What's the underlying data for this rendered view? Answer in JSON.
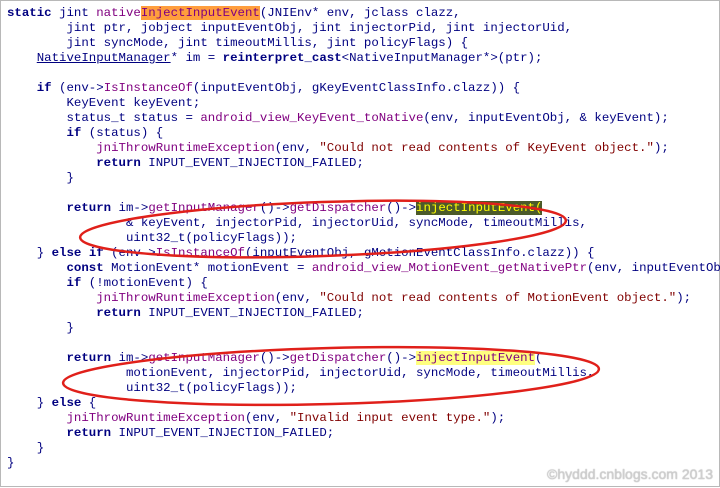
{
  "code_lines": [
    [
      {
        "t": "static",
        "c": "kw"
      },
      {
        "t": " "
      },
      {
        "t": "jint",
        "c": "ty"
      },
      {
        "t": " "
      },
      {
        "t": "native",
        "c": "fn"
      },
      {
        "t": "InjectInputEvent",
        "c": "hl1"
      },
      {
        "t": "(JNIEnv* env, jclass clazz,",
        "c": "var"
      }
    ],
    [
      {
        "t": "        jint ptr, jobject inputEventObj, jint injectorPid, jint injectorUid,",
        "c": "var"
      }
    ],
    [
      {
        "t": "        jint syncMode, jint timeoutMillis, jint policyFlags) {",
        "c": "var"
      }
    ],
    [
      {
        "t": "    "
      },
      {
        "t": "NativeInputManager",
        "c": "tu"
      },
      {
        "t": "* im = ",
        "c": "var"
      },
      {
        "t": "reinterpret_cast",
        "c": "kw"
      },
      {
        "t": "<NativeInputManager*>(ptr);",
        "c": "var"
      }
    ],
    [
      {
        "t": ""
      }
    ],
    [
      {
        "t": "    "
      },
      {
        "t": "if",
        "c": "kw"
      },
      {
        "t": " (env->",
        "c": "var"
      },
      {
        "t": "IsInstanceOf",
        "c": "fn"
      },
      {
        "t": "(inputEventObj, gKeyEventClassInfo.clazz)) {",
        "c": "var"
      }
    ],
    [
      {
        "t": "        KeyEvent keyEvent;",
        "c": "var"
      }
    ],
    [
      {
        "t": "        status_t status = ",
        "c": "var"
      },
      {
        "t": "android_view_KeyEvent_toNative",
        "c": "fn"
      },
      {
        "t": "(env, inputEventObj, & keyEvent);",
        "c": "var"
      }
    ],
    [
      {
        "t": "        "
      },
      {
        "t": "if",
        "c": "kw"
      },
      {
        "t": " (status) {",
        "c": "var"
      }
    ],
    [
      {
        "t": "            "
      },
      {
        "t": "jniThrowRuntimeException",
        "c": "fn"
      },
      {
        "t": "(env, ",
        "c": "var"
      },
      {
        "t": "\"Could not read contents of KeyEvent object.\"",
        "c": "str"
      },
      {
        "t": ");",
        "c": "var"
      }
    ],
    [
      {
        "t": "            "
      },
      {
        "t": "return",
        "c": "kw"
      },
      {
        "t": " INPUT_EVENT_INJECTION_FAILED;",
        "c": "var"
      }
    ],
    [
      {
        "t": "        }",
        "c": "var"
      }
    ],
    [
      {
        "t": ""
      }
    ],
    [
      {
        "t": "        "
      },
      {
        "t": "return",
        "c": "kw"
      },
      {
        "t": " im->",
        "c": "var"
      },
      {
        "t": "getInputManager",
        "c": "fn"
      },
      {
        "t": "()->",
        "c": "var"
      },
      {
        "t": "getDispatcher",
        "c": "fn"
      },
      {
        "t": "()->",
        "c": "var"
      },
      {
        "t": "injectInputEvent",
        "c": "hl2"
      },
      {
        "t": "(",
        "c": "hl2"
      }
    ],
    [
      {
        "t": "                & keyEvent, injectorPid, injectorUid, syncMode, timeoutMillis,",
        "c": "var"
      }
    ],
    [
      {
        "t": "                uint32_t(policyFlags));",
        "c": "var"
      }
    ],
    [
      {
        "t": "    } ",
        "c": "var"
      },
      {
        "t": "else",
        "c": "kw"
      },
      {
        "t": " "
      },
      {
        "t": "if",
        "c": "kw"
      },
      {
        "t": " (env->",
        "c": "var"
      },
      {
        "t": "IsInstanceOf",
        "c": "fn"
      },
      {
        "t": "(inputEventObj, gMotionEventClassInfo.clazz)) {",
        "c": "var"
      }
    ],
    [
      {
        "t": "        "
      },
      {
        "t": "const",
        "c": "kw"
      },
      {
        "t": " MotionEvent* motionEvent = ",
        "c": "var"
      },
      {
        "t": "android_view_MotionEvent_getNativePtr",
        "c": "fn"
      },
      {
        "t": "(env, inputEventObj);",
        "c": "var"
      }
    ],
    [
      {
        "t": "        "
      },
      {
        "t": "if",
        "c": "kw"
      },
      {
        "t": " (!motionEvent) {",
        "c": "var"
      }
    ],
    [
      {
        "t": "            "
      },
      {
        "t": "jniThrowRuntimeException",
        "c": "fn"
      },
      {
        "t": "(env, ",
        "c": "var"
      },
      {
        "t": "\"Could not read contents of MotionEvent object.\"",
        "c": "str"
      },
      {
        "t": ");",
        "c": "var"
      }
    ],
    [
      {
        "t": "            "
      },
      {
        "t": "return",
        "c": "kw"
      },
      {
        "t": " INPUT_EVENT_INJECTION_FAILED;",
        "c": "var"
      }
    ],
    [
      {
        "t": "        }",
        "c": "var"
      }
    ],
    [
      {
        "t": ""
      }
    ],
    [
      {
        "t": "        "
      },
      {
        "t": "return",
        "c": "kw"
      },
      {
        "t": " im->",
        "c": "var"
      },
      {
        "t": "getInputManager",
        "c": "fn"
      },
      {
        "t": "()->",
        "c": "var"
      },
      {
        "t": "getDispatcher",
        "c": "fn"
      },
      {
        "t": "()->",
        "c": "var"
      },
      {
        "t": "injectInputEvent",
        "c": "hl3"
      },
      {
        "t": "(",
        "c": "var"
      }
    ],
    [
      {
        "t": "                motionEvent, injectorPid, injectorUid, syncMode, timeoutMillis,",
        "c": "var"
      }
    ],
    [
      {
        "t": "                uint32_t(policyFlags));",
        "c": "var"
      }
    ],
    [
      {
        "t": "    } ",
        "c": "var"
      },
      {
        "t": "else",
        "c": "kw"
      },
      {
        "t": " {",
        "c": "var"
      }
    ],
    [
      {
        "t": "        "
      },
      {
        "t": "jniThrowRuntimeException",
        "c": "fn"
      },
      {
        "t": "(env, ",
        "c": "var"
      },
      {
        "t": "\"Invalid input event type.\"",
        "c": "str"
      },
      {
        "t": ");",
        "c": "var"
      }
    ],
    [
      {
        "t": "        "
      },
      {
        "t": "return",
        "c": "kw"
      },
      {
        "t": " INPUT_EVENT_INJECTION_FAILED;",
        "c": "var"
      }
    ],
    [
      {
        "t": "    }",
        "c": "var"
      }
    ],
    [
      {
        "t": "}",
        "c": "var"
      }
    ]
  ],
  "annotation_color": "#e0201a",
  "watermark": "©hyddd.cnblogs.com 2013"
}
